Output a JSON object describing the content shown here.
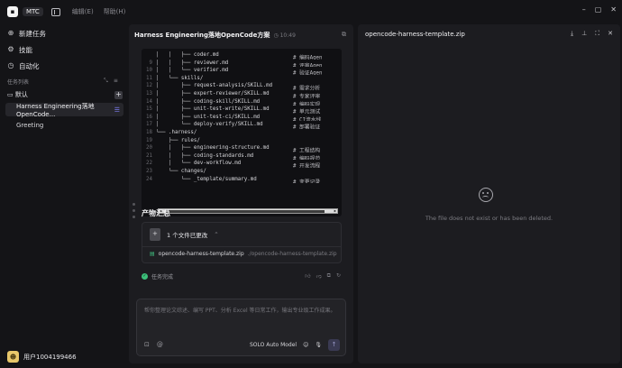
{
  "app": {
    "logo": "⬛",
    "name": "MTC",
    "menus": [
      "编辑(E)",
      "帮助(H)"
    ]
  },
  "sidebar": {
    "nav": [
      {
        "label": "新建任务",
        "icon": "new-task-icon"
      },
      {
        "label": "技能",
        "icon": "skills-icon"
      },
      {
        "label": "自动化",
        "icon": "automation-icon"
      }
    ],
    "section_label": "任务列表",
    "group": "默认",
    "tasks": [
      {
        "label": "Harness Engineering落地OpenCode...",
        "active": true
      },
      {
        "label": "Greeting",
        "active": false
      }
    ],
    "user": "用户1004199466"
  },
  "chat": {
    "title": "Harness Engineering落地OpenCode方案",
    "time": "10:49",
    "code_lines": [
      {
        "n": "",
        "code": "│   │   ├── coder.md",
        "comment": "# 编码Agen"
      },
      {
        "n": "9",
        "code": "│   │   ├── reviewer.md",
        "comment": "# 评审Agen"
      },
      {
        "n": "10",
        "code": "│   │   └── verifier.md",
        "comment": "# 验证Agen"
      },
      {
        "n": "11",
        "code": "│   └── skills/",
        "comment": ""
      },
      {
        "n": "12",
        "code": "│       ├── request-analysis/SKILL.md",
        "comment": "# 需求分析"
      },
      {
        "n": "13",
        "code": "│       ├── expert-reviewer/SKILL.md",
        "comment": "# 专家评审"
      },
      {
        "n": "14",
        "code": "│       ├── coding-skill/SKILL.md",
        "comment": "# 编码实现"
      },
      {
        "n": "15",
        "code": "│       ├── unit-test-write/SKILL.md",
        "comment": "# 单元测试"
      },
      {
        "n": "16",
        "code": "│       ├── unit-test-ci/SKILL.md",
        "comment": "# CI流水线"
      },
      {
        "n": "17",
        "code": "│       └── deploy-verify/SKILL.md",
        "comment": "# 部署验证"
      },
      {
        "n": "18",
        "code": "└── .harness/",
        "comment": ""
      },
      {
        "n": "19",
        "code": "    ├── rules/",
        "comment": ""
      },
      {
        "n": "20",
        "code": "    │   ├── engineering-structure.md",
        "comment": "# 工程结构"
      },
      {
        "n": "21",
        "code": "    │   ├── coding-standards.md",
        "comment": "# 编码规范"
      },
      {
        "n": "22",
        "code": "    │   └── dev-workflow.md",
        "comment": "# 开发流程"
      },
      {
        "n": "23",
        "code": "    └── changes/",
        "comment": ""
      },
      {
        "n": "24",
        "code": "        └── _template/summary.md",
        "comment": "# 变更记录"
      }
    ],
    "products_heading": "产物汇总",
    "files_changed": "1 个文件已更改",
    "file_name": "opencode-harness-template.zip",
    "file_path": "./opencode-harness-template.zip",
    "status": "任务完成",
    "input_placeholder": "帮你整理论文综述、编写 PPT、分析 Excel 等日常工作，输出专业级工作成果。",
    "model": "SOLO Auto Model"
  },
  "preview": {
    "title": "opencode-harness-template.zip",
    "error": "The file does not exist or has been deleted."
  }
}
